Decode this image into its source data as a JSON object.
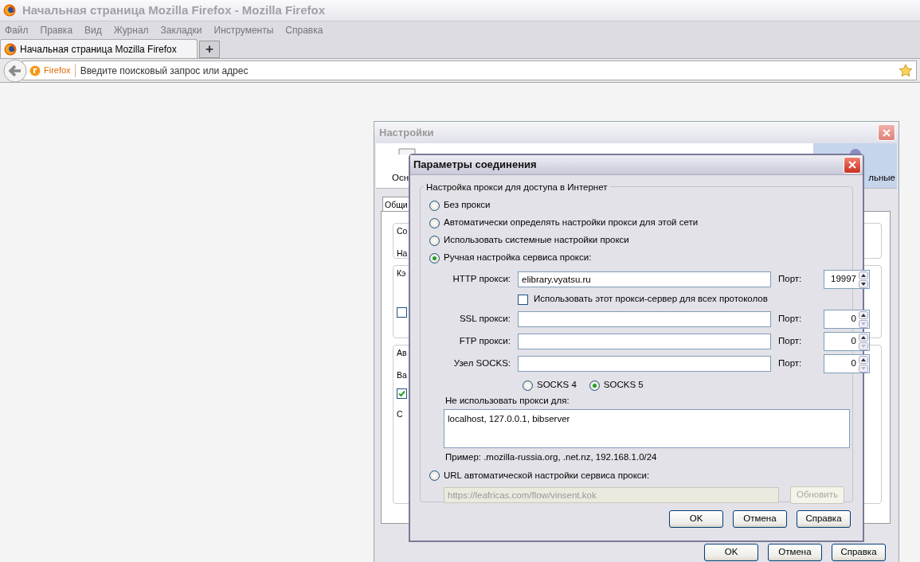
{
  "browser": {
    "title": "Начальная страница Mozilla Firefox - Mozilla Firefox",
    "menu": [
      "Файл",
      "Правка",
      "Вид",
      "Журнал",
      "Закладки",
      "Инструменты",
      "Справка"
    ],
    "tabs": [
      {
        "label": "Начальная страница Mozilla Firefox",
        "selected": true
      }
    ],
    "new_tab": "+",
    "identity": "Firefox",
    "address": {
      "placeholder": "Введите поисковый запрос или адрес"
    }
  },
  "settings_window": {
    "title": "Настройки",
    "toolbar": [
      {
        "label": "Осн",
        "selected": false
      },
      {
        "label": "льные",
        "selected": true
      }
    ],
    "tab": "Общи",
    "fragments": [
      "Со",
      "На",
      "Кэ",
      "Ав",
      "Ва",
      "С"
    ],
    "checkboxes": [
      {
        "checked": false
      },
      {
        "checked": true
      }
    ],
    "buttons": [
      "OK",
      "Отмена",
      "Справка"
    ]
  },
  "dialog": {
    "title": "Параметры соединения",
    "group": "Настройка прокси для доступа в Интернет",
    "modes": [
      {
        "label": "Без прокси",
        "selected": false
      },
      {
        "label": "Автоматически определять настройки прокси для этой сети",
        "selected": false
      },
      {
        "label": "Использовать системные настройки прокси",
        "selected": false
      },
      {
        "label": "Ручная настройка сервиса прокси:",
        "selected": true
      }
    ],
    "proxies": [
      {
        "label": "HTTP прокси:",
        "value": "elibrary.vyatsu.ru",
        "port_label": "Порт:",
        "port": "19997"
      },
      {
        "label": "SSL прокси:",
        "port_label": "Порт:",
        "port": "0"
      },
      {
        "label": "FTP прокси:",
        "port_label": "Порт:",
        "port": "0"
      },
      {
        "label": "Узел SOCKS:",
        "port_label": "Порт:",
        "port": "0"
      }
    ],
    "share_all": {
      "label": "Использовать этот прокси-сервер для всех протоколов",
      "checked": false
    },
    "socks_versions": [
      {
        "label": "SOCKS 4",
        "selected": false
      },
      {
        "label": "SOCKS 5",
        "selected": true
      }
    ],
    "no_proxy_label": "Не использовать прокси для:",
    "no_proxy": "localhost, 127.0.0.1, bibserver",
    "example": "Пример: .mozilla-russia.org, .net.nz, 192.168.1.0/24",
    "auto_url": {
      "label": "URL автоматической настройки сервиса прокси:",
      "selected": false,
      "value": "https://leafricas.com/flow/vinsent.kok",
      "disabled": true
    },
    "reload": {
      "label": "Обновить",
      "disabled": true
    },
    "buttons": [
      "OK",
      "Отмена",
      "Справка"
    ]
  }
}
